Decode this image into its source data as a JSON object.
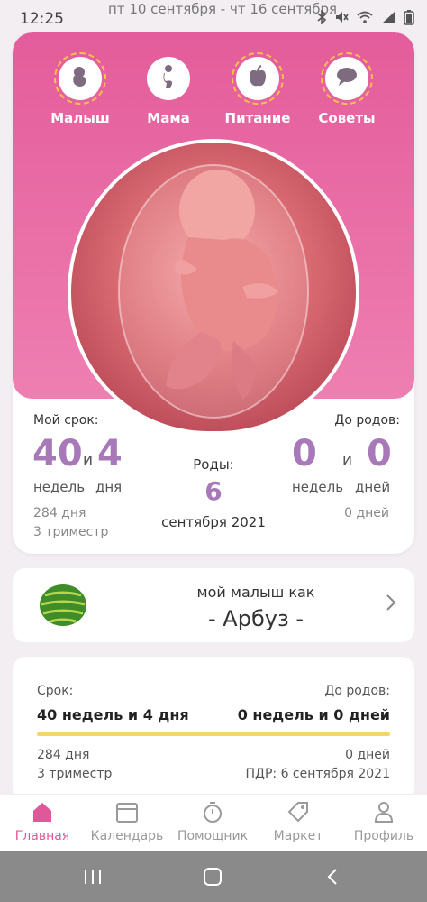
{
  "status_bar": {
    "time": "12:25",
    "date_range": "пт 10 сентября - чт 16 сентября",
    "icons": [
      "notification-icon",
      "bluetooth-icon",
      "mute-icon",
      "wifi-icon",
      "signal-icon",
      "battery-icon"
    ]
  },
  "top_nav": {
    "items": [
      {
        "label": "Малыш",
        "icon": "baby-icon"
      },
      {
        "label": "Мама",
        "icon": "mom-icon"
      },
      {
        "label": "Питание",
        "icon": "apple-icon"
      },
      {
        "label": "Советы",
        "icon": "chat-bubble-icon"
      }
    ]
  },
  "pregnancy": {
    "term_label": "Мой срок:",
    "weeks": "40",
    "weeks_unit": "недель",
    "and": "и",
    "days": "4",
    "days_unit": "дня",
    "total_days": "284 дня",
    "trimester": "3 триместр",
    "birth_label": "Роды:",
    "birth_day": "6",
    "birth_month_year": "сентября 2021",
    "until_label": "До родов:",
    "until_weeks": "0",
    "until_weeks_unit": "недель",
    "until_days": "0",
    "until_days_unit": "дней",
    "until_total_days": "0 дней"
  },
  "fruit": {
    "subtitle": "мой малыш как",
    "name": "- Арбуз -",
    "icon": "watermelon-icon"
  },
  "timeline": {
    "term_label": "Срок:",
    "term_value": "40 недель и 4 дня",
    "until_label": "До родов:",
    "until_value": "0 недель и 0 дней",
    "progress": 1.0,
    "total_days": "284 дня",
    "trimester": "3 триместр",
    "until_days": "0 дней",
    "due_date": "ПДР: 6 сентября 2021"
  },
  "tab_bar": {
    "items": [
      {
        "label": "Главная",
        "icon": "home-icon",
        "active": true
      },
      {
        "label": "Календарь",
        "icon": "calendar-icon",
        "active": false
      },
      {
        "label": "Помощник",
        "icon": "stopwatch-icon",
        "active": false
      },
      {
        "label": "Маркет",
        "icon": "tag-icon",
        "active": false
      },
      {
        "label": "Профиль",
        "icon": "profile-icon",
        "active": false
      }
    ]
  },
  "colors": {
    "accent_pink": "#e45c9b",
    "accent_purple": "#a779b8",
    "progress_yellow": "#f5d46a"
  }
}
